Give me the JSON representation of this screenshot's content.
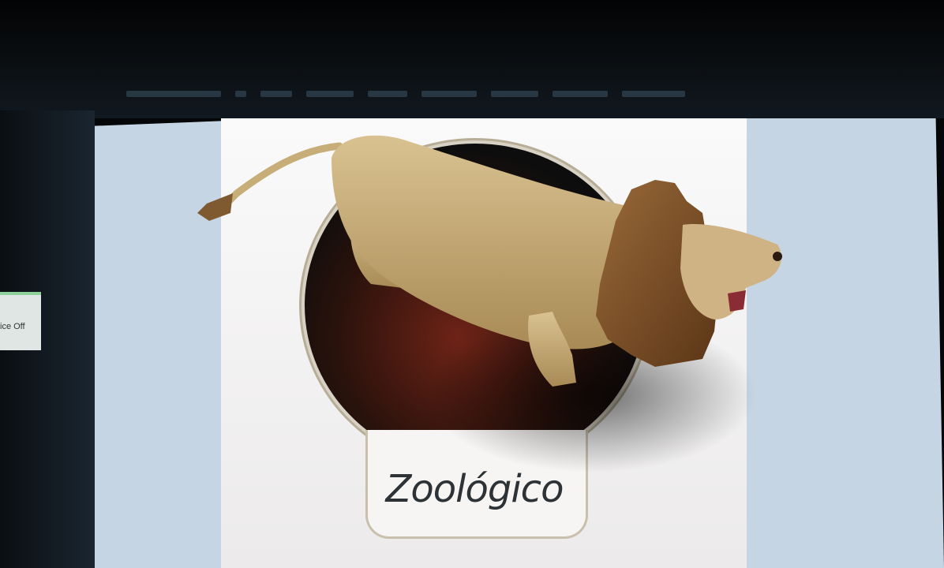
{
  "card": {
    "title": "Zoológico"
  },
  "sidebar_widget": {
    "label": "ice Off"
  },
  "model": {
    "subject": "lion-3d-model"
  },
  "colors": {
    "screen_bg": "#c7d6e6",
    "card_bg": "#f5f4f3",
    "lion_body": "#cdb27c",
    "lion_mane": "#7a4b23",
    "label_text": "#2d3236"
  }
}
